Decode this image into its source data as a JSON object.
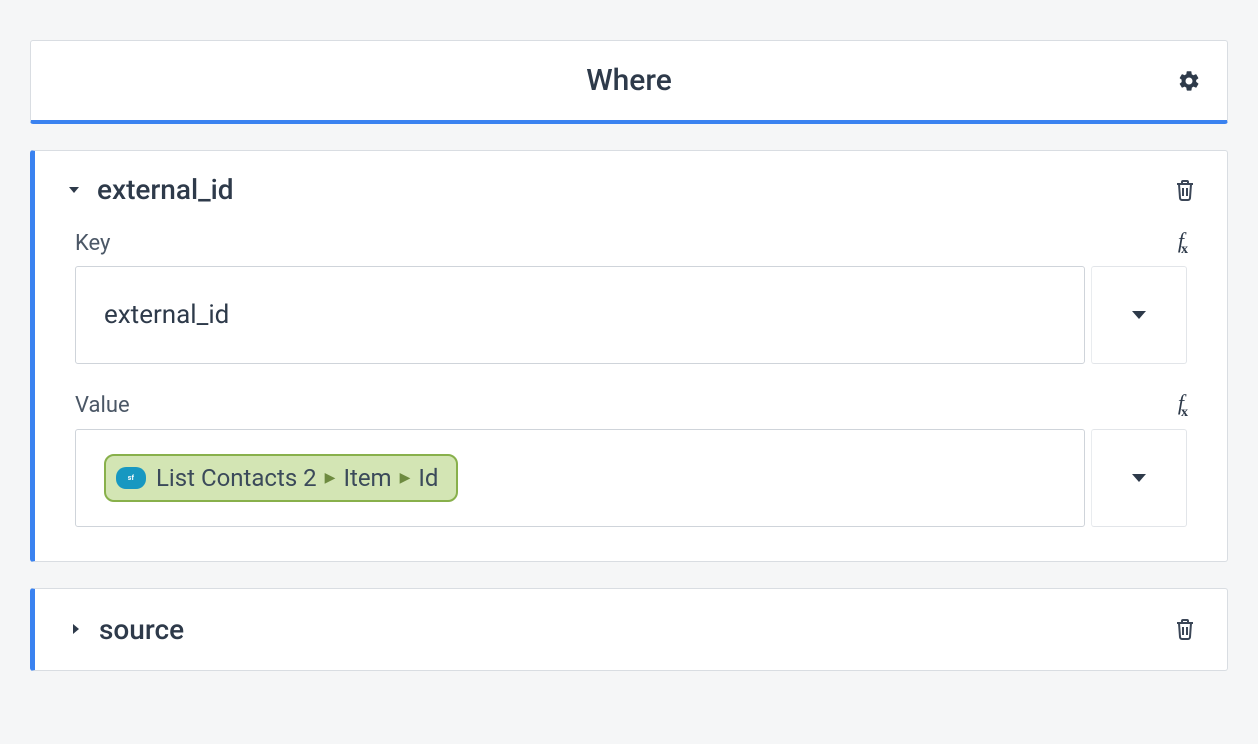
{
  "header": {
    "title": "Where"
  },
  "sections": [
    {
      "id": "external_id",
      "title": "external_id",
      "expanded": true,
      "fields": {
        "key": {
          "label": "Key",
          "value": "external_id"
        },
        "value": {
          "label": "Value",
          "pill": {
            "source_icon": "salesforce",
            "parts": [
              "List Contacts 2",
              "Item",
              "Id"
            ]
          }
        }
      }
    },
    {
      "id": "source",
      "title": "source",
      "expanded": false
    }
  ]
}
